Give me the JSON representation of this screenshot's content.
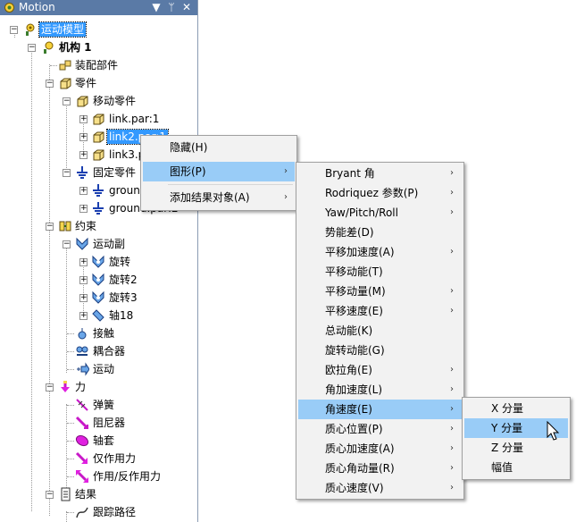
{
  "window": {
    "title": "Motion"
  },
  "tree": {
    "root": "运动模型",
    "mechanism": "机构 1",
    "assembly": "装配部件",
    "parts": "零件",
    "moving_parts": "移动零件",
    "link1": "link.par:1",
    "link2": "link2.par:1",
    "link3": "link3.par:1",
    "fixed_parts": "固定零件",
    "ground1": "ground.par:1",
    "ground2": "ground.par:2",
    "constraints": "约束",
    "joints": "运动副",
    "joint1": "旋转",
    "joint2": "旋转2",
    "joint3": "旋转3",
    "joint4": "轴18",
    "contact": "接触",
    "coupler": "耦合器",
    "motion": "运动",
    "forces": "力",
    "spring": "弹簧",
    "damper": "阻尼器",
    "bushing": "轴套",
    "action_only": "仅作用力",
    "action_reaction": "作用/反作用力",
    "results": "结果",
    "trace": "跟踪路径"
  },
  "context_menu": {
    "items": [
      "隐藏(H)",
      "图形(P)",
      "添加结果对象(A)"
    ]
  },
  "graph_menu": {
    "items": [
      "Bryant 角",
      "Rodriquez 参数(P)",
      "Yaw/Pitch/Roll",
      "势能差(D)",
      "平移加速度(A)",
      "平移动能(T)",
      "平移动量(M)",
      "平移速度(E)",
      "总动能(K)",
      "旋转动能(G)",
      "欧拉角(E)",
      "角加速度(L)",
      "角速度(E)",
      "质心位置(P)",
      "质心加速度(A)",
      "质心角动量(R)",
      "质心速度(V)"
    ]
  },
  "component_menu": {
    "items": [
      "X 分量",
      "Y 分量",
      "Z 分量",
      "幅值"
    ]
  },
  "colors": {
    "titlebar": "#5a7aa6",
    "selection": "#3399ff",
    "menu_highlight": "#99ccf7",
    "menu_bg": "#f2f2f2"
  }
}
